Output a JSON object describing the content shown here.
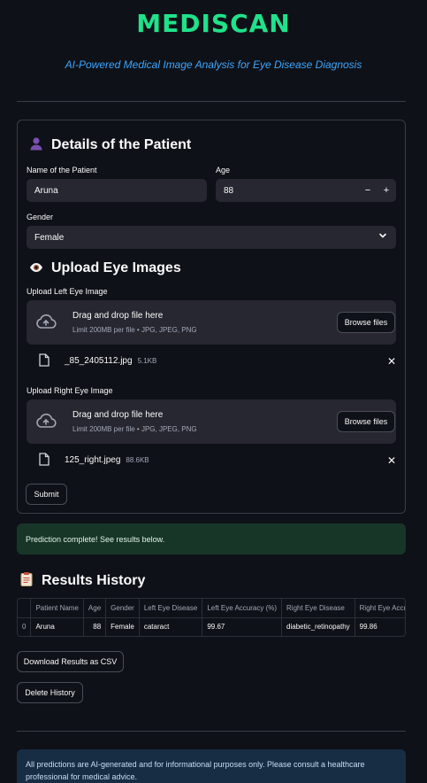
{
  "app": {
    "title": "MEDISCAN",
    "subtitle": "AI-Powered Medical Image Analysis for Eye Disease Diagnosis"
  },
  "patient": {
    "heading": "Details of the Patient",
    "name_label": "Name of the Patient",
    "name_value": "Aruna",
    "age_label": "Age",
    "age_value": "88",
    "age_minus": "−",
    "age_plus": "+",
    "gender_label": "Gender",
    "gender_value": "Female"
  },
  "upload": {
    "heading": "Upload Eye Images",
    "left_label": "Upload Left Eye Image",
    "right_label": "Upload Right Eye Image",
    "drag_text": "Drag and drop file here",
    "limit_text": "Limit 200MB per file • JPG, JPEG, PNG",
    "browse_label": "Browse files",
    "left_file": {
      "name": "_85_2405112.jpg",
      "size": "5.1KB"
    },
    "right_file": {
      "name": "125_right.jpeg",
      "size": "88.6KB"
    },
    "remove_glyph": "✕",
    "submit_label": "Submit"
  },
  "status": {
    "success_message": "Prediction complete! See results below."
  },
  "results": {
    "heading": "Results History",
    "columns": [
      "",
      "Patient Name",
      "Age",
      "Gender",
      "Left Eye Disease",
      "Left Eye Accuracy (%)",
      "Right Eye Disease",
      "Right Eye Accuracy (%)"
    ],
    "rows": [
      [
        "0",
        "Aruna",
        "88",
        "Female",
        "cataract",
        "99.67",
        "diabetic_retinopathy",
        "99.86"
      ]
    ],
    "download_label": "Download Results as CSV",
    "delete_label": "Delete History"
  },
  "disclaimer": "All predictions are AI-generated and for informational purposes only. Please consult a healthcare professional for medical advice.",
  "icons": {
    "patient": "person-icon",
    "upload": "eye-icon",
    "results": "clipboard-icon",
    "dropzone": "cloud-upload-icon",
    "file": "file-icon"
  },
  "colors": {
    "background": "#0e1117",
    "title": "#1fe28a",
    "subtitle": "#3ea6ff",
    "input": "#262730",
    "success_bg": "#183628",
    "info_bg": "#172d44"
  }
}
